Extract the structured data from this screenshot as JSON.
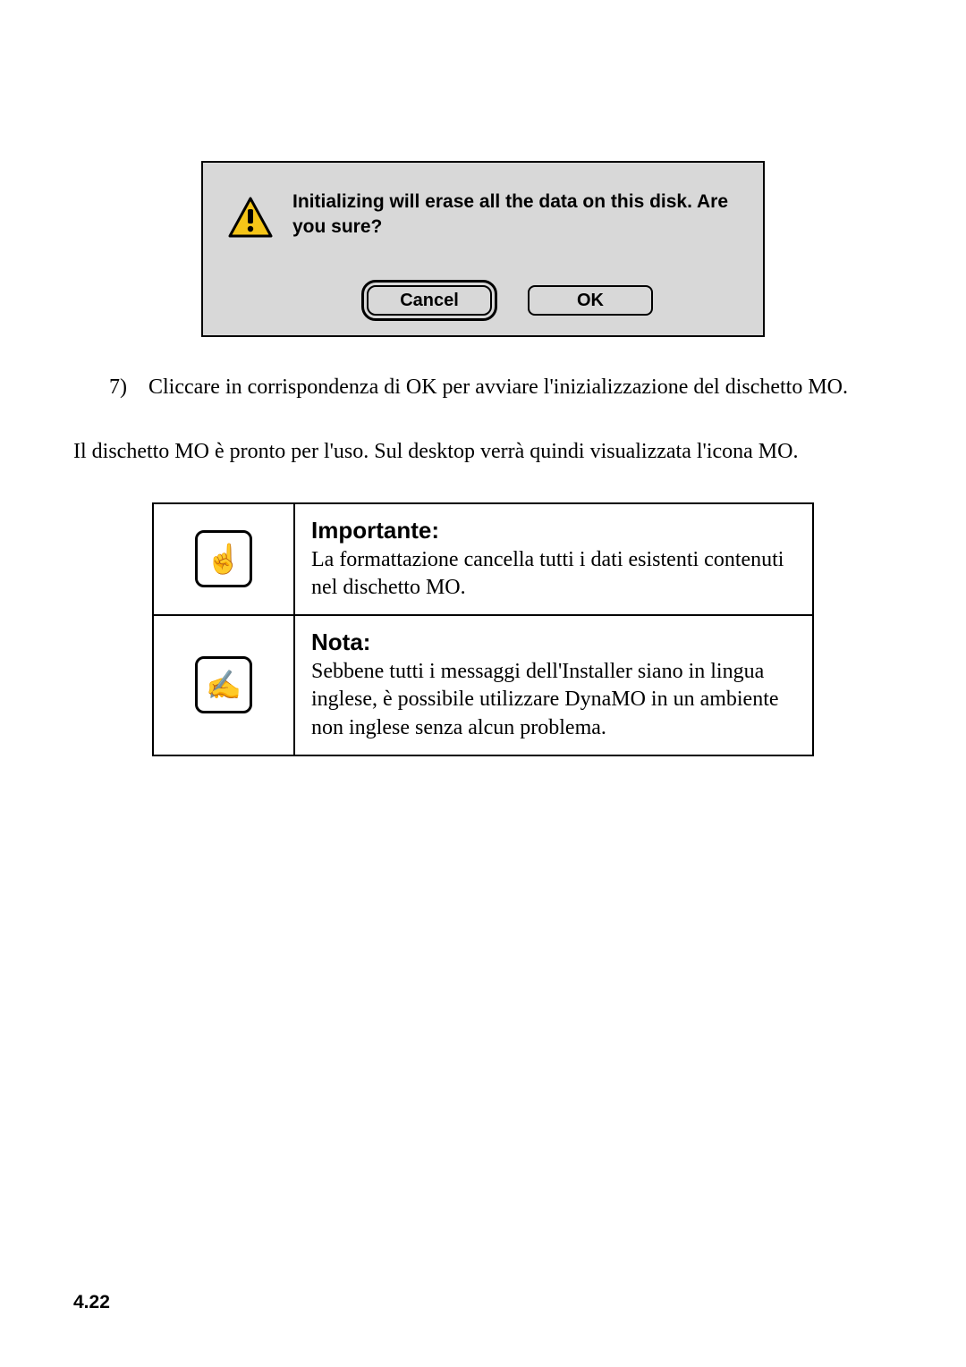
{
  "dialog": {
    "message": "Initializing will erase all the data on this disk. Are you sure?",
    "cancel_label": "Cancel",
    "ok_label": "OK"
  },
  "step": {
    "number": "7)",
    "text": "Cliccare in corrispondenza di OK per avviare l'inizializzazione del dischetto MO."
  },
  "paragraph": "Il dischetto MO è pronto per l'uso. Sul desktop verrà quindi visualizzata l'icona MO.",
  "importante": {
    "heading": "Importante:",
    "text": "La formattazione cancella tutti i dati esistenti contenuti nel dischetto MO."
  },
  "nota": {
    "heading": "Nota:",
    "text": "Sebbene tutti i messaggi dell'Installer siano in lingua inglese, è possibile utilizzare DynaMO in un ambiente non inglese senza alcun problema."
  },
  "icons": {
    "importante_glyph": "☝",
    "nota_glyph": "✍"
  },
  "page_number": "4.22"
}
